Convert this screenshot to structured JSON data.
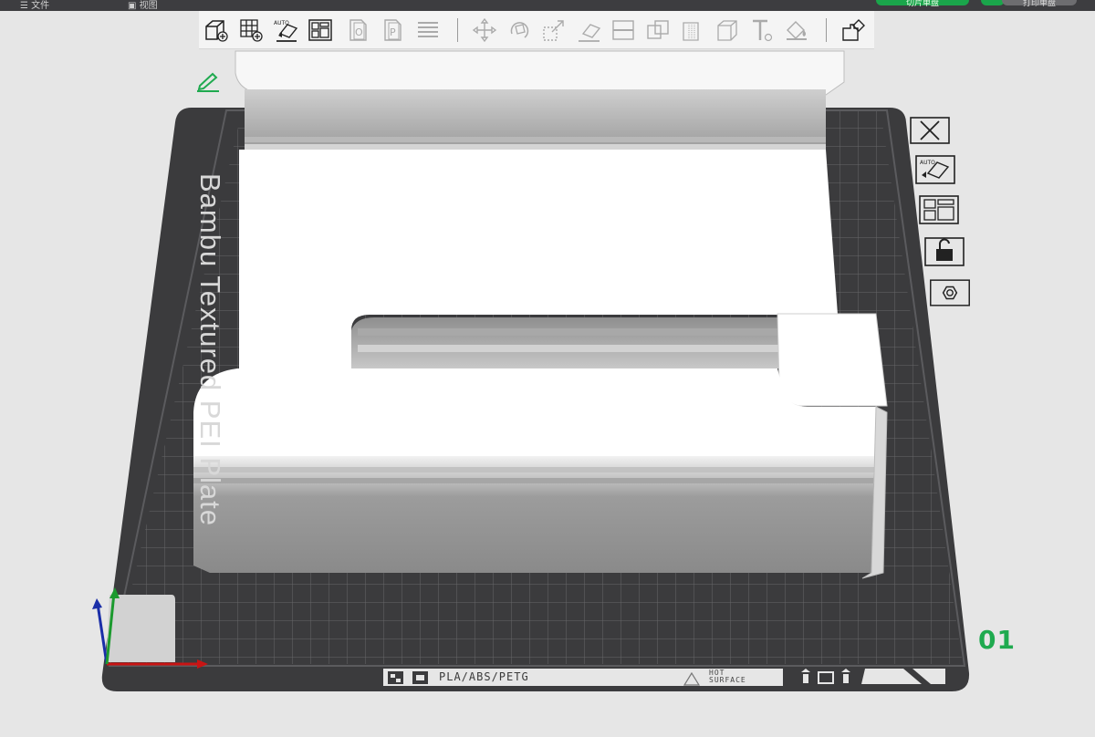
{
  "topbar": {
    "menu_file": "文件",
    "menu_view": "视图",
    "slice_plate": "切片单盘",
    "print_plate": "打印单盘"
  },
  "toolbar": {
    "items": [
      {
        "name": "add-object-icon"
      },
      {
        "name": "add-plate-icon"
      },
      {
        "name": "auto-orient-icon",
        "label": "AUTO"
      },
      {
        "name": "arrange-icon"
      },
      {
        "name": "split-objects-icon",
        "label": "O"
      },
      {
        "name": "split-parts-icon",
        "label": "P"
      },
      {
        "name": "layers-icon"
      },
      {
        "name": "move-icon"
      },
      {
        "name": "rotate-icon"
      },
      {
        "name": "scale-icon"
      },
      {
        "name": "lay-on-face-icon"
      },
      {
        "name": "cut-icon"
      },
      {
        "name": "boolean-icon"
      },
      {
        "name": "support-paint-icon"
      },
      {
        "name": "seam-paint-icon"
      },
      {
        "name": "text-icon"
      },
      {
        "name": "color-paint-icon"
      },
      {
        "name": "assembly-icon"
      }
    ]
  },
  "side_panel": {
    "items": [
      {
        "name": "close-icon"
      },
      {
        "name": "auto-orient-plate-icon",
        "label": "AUTO"
      },
      {
        "name": "arrange-plate-icon"
      },
      {
        "name": "lock-icon"
      },
      {
        "name": "plate-settings-icon"
      }
    ]
  },
  "plate": {
    "name": "Bambu Textured PEI Plate",
    "number": "01",
    "material": "PLA/ABS/PETG",
    "hot_line1": "HOT",
    "hot_line2": "SURFACE"
  },
  "colors": {
    "plate": "#3b3b3d",
    "grid": "#6c6c6e",
    "model": "#ffffff",
    "accent": "#1faa4f",
    "toolbar_bg": "#f4f4f4"
  }
}
